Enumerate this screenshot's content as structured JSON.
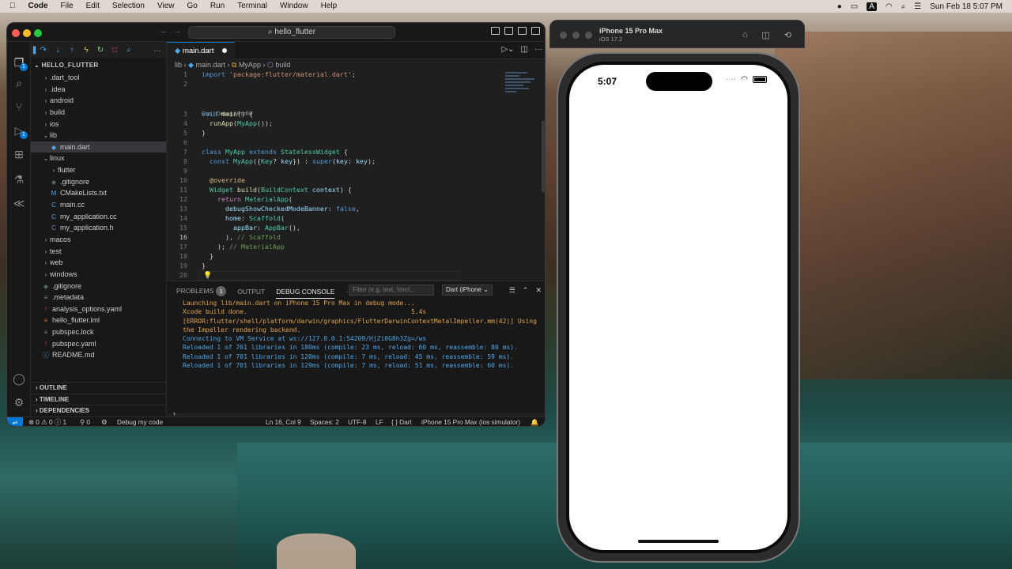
{
  "menubar": {
    "app": "Code",
    "items": [
      "File",
      "Edit",
      "Selection",
      "View",
      "Go",
      "Run",
      "Terminal",
      "Window",
      "Help"
    ],
    "clock": "Sun Feb 18  5:07 PM",
    "input_source": "A"
  },
  "vscode": {
    "command_center": "hello_flutter",
    "explorer_title": "HELLO_FLUTTER",
    "tree": [
      {
        "label": ".dart_tool",
        "kind": "folder",
        "depth": 1,
        "chev": "›"
      },
      {
        "label": ".idea",
        "kind": "folder",
        "depth": 1,
        "chev": "›"
      },
      {
        "label": "android",
        "kind": "folder",
        "depth": 1,
        "chev": "›"
      },
      {
        "label": "build",
        "kind": "folder",
        "depth": 1,
        "chev": "›"
      },
      {
        "label": "ios",
        "kind": "folder",
        "depth": 1,
        "chev": "›"
      },
      {
        "label": "lib",
        "kind": "folder",
        "depth": 1,
        "chev": "⌄"
      },
      {
        "label": "main.dart",
        "kind": "dart",
        "depth": 2,
        "selected": true
      },
      {
        "label": "linux",
        "kind": "folder",
        "depth": 1,
        "chev": "⌄"
      },
      {
        "label": "flutter",
        "kind": "folder",
        "depth": 2,
        "chev": "›"
      },
      {
        "label": ".gitignore",
        "kind": "git",
        "depth": 2
      },
      {
        "label": "CMakeLists.txt",
        "kind": "cmake",
        "depth": 2
      },
      {
        "label": "main.cc",
        "kind": "cc",
        "depth": 2
      },
      {
        "label": "my_application.cc",
        "kind": "cc",
        "depth": 2
      },
      {
        "label": "my_application.h",
        "kind": "h",
        "depth": 2
      },
      {
        "label": "macos",
        "kind": "folder",
        "depth": 1,
        "chev": "›"
      },
      {
        "label": "test",
        "kind": "folder",
        "depth": 1,
        "chev": "›"
      },
      {
        "label": "web",
        "kind": "folder",
        "depth": 1,
        "chev": "›"
      },
      {
        "label": "windows",
        "kind": "folder",
        "depth": 1,
        "chev": "›"
      },
      {
        "label": ".gitignore",
        "kind": "git",
        "depth": 1
      },
      {
        "label": ".metadata",
        "kind": "meta",
        "depth": 1
      },
      {
        "label": "analysis_options.yaml",
        "kind": "yaml-warn",
        "depth": 1
      },
      {
        "label": "hello_flutter.iml",
        "kind": "iml",
        "depth": 1
      },
      {
        "label": "pubspec.lock",
        "kind": "lock",
        "depth": 1
      },
      {
        "label": "pubspec.yaml",
        "kind": "yaml-warn",
        "depth": 1
      },
      {
        "label": "README.md",
        "kind": "md",
        "depth": 1
      }
    ],
    "sections": [
      "OUTLINE",
      "TIMELINE",
      "DEPENDENCIES"
    ],
    "tab": "main.dart",
    "breadcrumb": [
      "lib",
      "main.dart",
      "MyApp",
      "build"
    ],
    "codelens": "Run | Debug | Profile",
    "code_lines": [
      [
        [
          "kw",
          "import "
        ],
        [
          "st",
          "'package:flutter/material.dart'"
        ],
        [
          "",
          "; "
        ]
      ],
      [],
      [
        [
          "kw",
          "void "
        ],
        [
          "fn",
          "main"
        ],
        [
          "",
          "() {"
        ]
      ],
      [
        [
          "",
          "  "
        ],
        [
          "fn",
          "runApp"
        ],
        [
          "",
          "("
        ],
        [
          "ty",
          "MyApp"
        ],
        [
          "",
          "());"
        ]
      ],
      [
        [
          "",
          "}"
        ]
      ],
      [],
      [
        [
          "kw",
          "class "
        ],
        [
          "ty",
          "MyApp "
        ],
        [
          "kw",
          "extends "
        ],
        [
          "ty",
          "StatelessWidget "
        ],
        [
          "",
          "{"
        ]
      ],
      [
        [
          "",
          "  "
        ],
        [
          "kw",
          "const "
        ],
        [
          "ty",
          "MyApp"
        ],
        [
          "",
          "({"
        ],
        [
          "ty",
          "Key"
        ],
        [
          "",
          "? "
        ],
        [
          "pr",
          "key"
        ],
        [
          "",
          "}) : "
        ],
        [
          "kw",
          "super"
        ],
        [
          "",
          "("
        ],
        [
          "pr",
          "key"
        ],
        [
          "",
          ": "
        ],
        [
          "pr",
          "key"
        ],
        [
          "",
          ");"
        ]
      ],
      [],
      [
        [
          "",
          "  "
        ],
        [
          "an",
          "@override"
        ]
      ],
      [
        [
          "",
          "  "
        ],
        [
          "ty",
          "Widget "
        ],
        [
          "fn",
          "build"
        ],
        [
          "",
          "("
        ],
        [
          "ty",
          "BuildContext "
        ],
        [
          "pr",
          "context"
        ],
        [
          "",
          ") {"
        ]
      ],
      [
        [
          "",
          "    "
        ],
        [
          "ctl",
          "return "
        ],
        [
          "ty",
          "MaterialApp"
        ],
        [
          "",
          "("
        ]
      ],
      [
        [
          "",
          "      "
        ],
        [
          "pr",
          "debugShowCheckedModeBanner"
        ],
        [
          "",
          ": "
        ],
        [
          "kw",
          "false"
        ],
        [
          "",
          ","
        ]
      ],
      [
        [
          "",
          "      "
        ],
        [
          "pr",
          "home"
        ],
        [
          "",
          ": "
        ],
        [
          "ty",
          "Scaffold"
        ],
        [
          "",
          "("
        ]
      ],
      [
        [
          "",
          "        "
        ],
        [
          "pr",
          "appBar"
        ],
        [
          "",
          ": "
        ],
        [
          "ty",
          "AppBar"
        ],
        [
          "",
          "(),"
        ]
      ],
      [
        [
          "",
          "      ),"
        ],
        [
          "cm",
          " // Scaffold"
        ]
      ],
      [
        [
          "",
          "    );"
        ],
        [
          "cm",
          " // MaterialApp"
        ]
      ],
      [
        [
          "",
          "  }"
        ]
      ],
      [
        [
          "",
          "}"
        ]
      ],
      []
    ],
    "panel_tabs": {
      "problems": "PROBLEMS",
      "problems_count": "1",
      "output": "OUTPUT",
      "debug_console": "DEBUG CONSOLE"
    },
    "filter_placeholder": "Filter (e.g. text, !excl...",
    "session_select": "Dart (iPhone",
    "console": [
      {
        "text": "Launching lib/main.dart on iPhone 15 Pro Max in debug mode...",
        "color": "orange"
      },
      {
        "text": "Xcode build done.                                           5.4s",
        "color": "orange"
      },
      {
        "text": "[ERROR:flutter/shell/platform/darwin/graphics/FlutterDarwinContextMetalImpeller.mm(42)] Using",
        "color": "orange"
      },
      {
        "text": "the Impeller rendering backend.",
        "color": "orange"
      },
      {
        "text": "Connecting to VM Service at ws://127.0.0.1:54209/HjZi0G8h3Zg=/ws",
        "color": "blue"
      },
      {
        "text": "Reloaded 1 of 701 libraries in 180ms (compile: 23 ms, reload: 60 ms, reassemble: 80 ms).",
        "color": "blue"
      },
      {
        "text": "Reloaded 1 of 701 libraries in 120ms (compile: 7 ms, reload: 45 ms, reassemble: 59 ms).",
        "color": "blue"
      },
      {
        "text": "Reloaded 1 of 701 libraries in 129ms (compile: 7 ms, reload: 51 ms, reassemble: 60 ms).",
        "color": "blue"
      }
    ],
    "status": {
      "errors": "0",
      "warnings": "0",
      "info": "1",
      "ports": "0",
      "debug": "Debug my code",
      "cursor": "Ln 16, Col 9",
      "spaces": "Spaces: 2",
      "encoding": "UTF-8",
      "eol": "LF",
      "language": "Dart",
      "device": "iPhone 15 Pro Max (ios simulator)"
    }
  },
  "simulator": {
    "title": "iPhone 15 Pro Max",
    "subtitle": "iOS 17.2",
    "time": "5:07"
  },
  "colors": {
    "accent": "#0078d4",
    "editor_bg": "#1f1f1f",
    "sidebar_bg": "#181818"
  }
}
